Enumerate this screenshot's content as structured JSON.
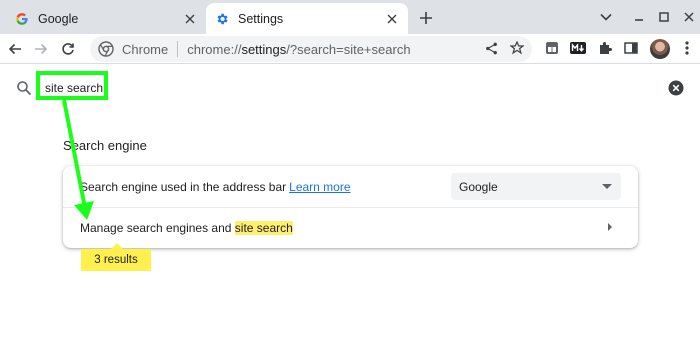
{
  "tabs": [
    {
      "title": "Google",
      "icon": "google-icon",
      "active": false
    },
    {
      "title": "Settings",
      "icon": "settings-gear-icon",
      "active": true
    }
  ],
  "omnibox": {
    "site_label": "Chrome",
    "url_prefix": "chrome://",
    "url_host": "settings",
    "url_path": "/?search=site+search"
  },
  "settings": {
    "search_value": "site search",
    "section_title": "Search engine",
    "row1_text": "Search engine used in the address bar",
    "row1_link": "Learn more",
    "engine_selected": "Google",
    "row2_text": "Manage search engines and ",
    "row2_highlight": "site search",
    "results_bubble": "3 results"
  },
  "colors": {
    "accent_link": "#1a73e8",
    "highlight": "#ffef6e",
    "annotation": "#1aff1a"
  }
}
